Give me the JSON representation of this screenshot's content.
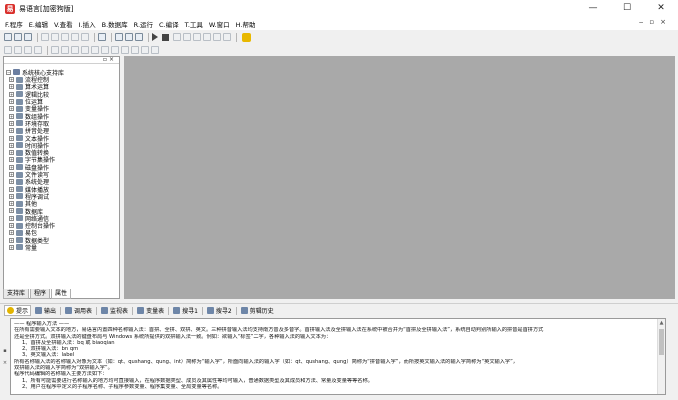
{
  "titlebar": {
    "app_icon": "易",
    "title": "易语言[加密狗版]",
    "buttons": [
      "minimize-icon",
      "maximize-icon",
      "close-icon"
    ]
  },
  "menubar": {
    "items": [
      "F.程序",
      "E.编辑",
      "V.查看",
      "I.插入",
      "B.数据库",
      "R.运行",
      "C.编译",
      "T.工具",
      "W.窗口",
      "H.帮助"
    ]
  },
  "left_panel": {
    "root_label": "系统核心支持库",
    "items": [
      "流程控制",
      "算术运算",
      "逻辑比较",
      "位运算",
      "变量操作",
      "数组操作",
      "环境存取",
      "拼音处理",
      "文本操作",
      "时间操作",
      "数值转换",
      "字节集操作",
      "磁盘操作",
      "文件读写",
      "系统处理",
      "媒体播放",
      "程序调试",
      "其他",
      "数据库",
      "网络通信",
      "控制台操作",
      "易包",
      "数据类型",
      "常量"
    ],
    "tabs": [
      "支持库",
      "程序",
      "属性"
    ]
  },
  "bottom_tabs": [
    "提示",
    "输出",
    "调用表",
    "监视表",
    "变量表",
    "搜寻1",
    "搜寻2",
    "剪辑历史"
  ],
  "hint_lines": [
    "—— 程序输入方法 ——",
    "  在所有需要输入文本的地方，易语言内置四种名称输入法：首拼、全拼、双拼、英文。三种拼音输入法均支持南方音及多音字。首拼输入法及全拼输入法在系统中被合并为“首拼及全拼输入法”，系统自动判别所输入的拼音是首拼方式",
    "还是全拼方式。双拼输入法的键盘布局与 Windows 系统所提供的双拼输入法一致。例如：欲输入“标签”二字，各种输入法的输入文本为：",
    "  1、首拼及全拼输入法：bq 或 biaoqian",
    "  2、双拼输入法：bn qm",
    "  3、英文输入法：label",
    "  所有名称输入法的名称输入对象为文本（如：qt、qushang、qung、int）简称为“输入字”，所面向输入法的输入字（如：qt、qushang、qung）简称为“拼音输入字”，而所按英文输入法的输入字简称为“英文输入字”，",
    "双拼输入法的输入字简称为“双拼输入字”。",
    "  程序代码编辑的名称输入主要方法如下：",
    "  1、所有可能需要进行名称输入的地方均可直接输入，在程序数据类型、成员及其属性等均可输入，普通数据类型及其成员和方法、常量及变量等等名称。",
    "  2、用户在程序中定义的子程序名称、子程序参数变量、程序集变量、全局变量等名称。"
  ]
}
